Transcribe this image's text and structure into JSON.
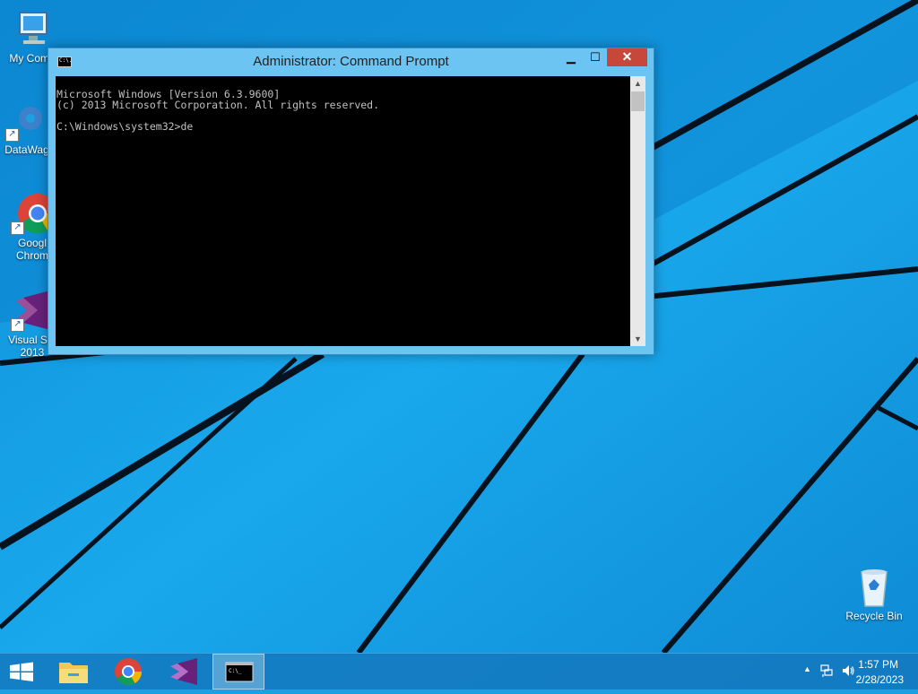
{
  "desktop": {
    "icons": [
      {
        "label": "My Comp",
        "icon": "computer-icon"
      },
      {
        "label": "DataWag",
        "icon": "datawagon-icon"
      },
      {
        "label": "Googl\nChrom",
        "icon": "chrome-icon"
      },
      {
        "label": "Visual Stu\n2013",
        "icon": "visual-studio-icon"
      },
      {
        "label": "Recycle Bin",
        "icon": "recycle-bin-icon"
      }
    ]
  },
  "window": {
    "title": "Administrator:  Command Prompt",
    "icon_text": "C:\\.",
    "buttons": {
      "minimize": "▁",
      "maximize": "☐",
      "close": "✕"
    },
    "console_lines": [
      "Microsoft Windows [Version 6.3.9600]",
      "(c) 2013 Microsoft Corporation. All rights reserved.",
      "",
      "C:\\Windows\\system32>de"
    ]
  },
  "taskbar": {
    "items": [
      {
        "name": "start",
        "icon": "windows-logo-icon"
      },
      {
        "name": "file-explorer",
        "icon": "folder-icon"
      },
      {
        "name": "chrome",
        "icon": "chrome-icon"
      },
      {
        "name": "visual-studio",
        "icon": "visual-studio-icon"
      },
      {
        "name": "command-prompt",
        "icon": "cmd-icon",
        "active": true
      }
    ],
    "tray": {
      "chevron": "▲",
      "time": "1:57 PM",
      "date": "2/28/2023"
    }
  },
  "colors": {
    "wallpaper": "#1ba1e2",
    "window_frame": "#6cc4f2",
    "close_button": "#c7483a"
  }
}
